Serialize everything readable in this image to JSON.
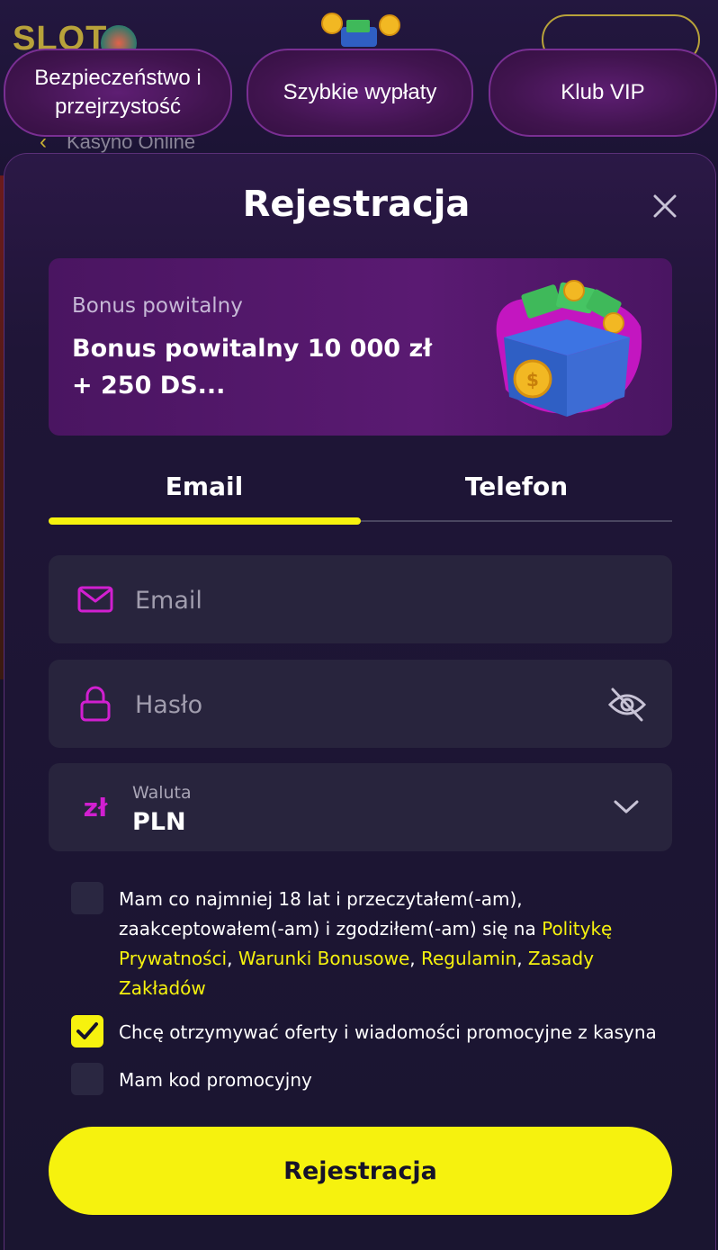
{
  "background": {
    "logo_text": "SLOTO",
    "back_link": "Kasyno Online"
  },
  "top_pills": [
    {
      "label": "Bezpieczeństwo i przejrzystość"
    },
    {
      "label": "Szybkie wypłaty"
    },
    {
      "label": "Klub VIP"
    }
  ],
  "modal": {
    "title": "Rejestracja",
    "close_icon": "close-icon"
  },
  "bonus": {
    "label": "Bonus powitalny",
    "value": "Bonus powitalny 10 000 zł + 250 DS..."
  },
  "tabs": [
    {
      "label": "Email",
      "active": true
    },
    {
      "label": "Telefon",
      "active": false
    }
  ],
  "fields": {
    "email": {
      "placeholder": "Email",
      "icon": "mail-icon"
    },
    "password": {
      "placeholder": "Hasło",
      "icon": "lock-icon",
      "toggle_icon": "eye-off-icon"
    },
    "currency": {
      "label": "Waluta",
      "value": "PLN",
      "glyph": "zł"
    }
  },
  "consents": {
    "age": {
      "checked": false,
      "text": "Mam co najmniej 18 lat i przeczytałem(-am), zaakceptowałem(-am) i zgodziłem(-am) się na",
      "links": [
        "Politykę Prywatności",
        "Warunki Bonusowe",
        "Regulamin",
        "Zasady Zakładów"
      ],
      "separator": ", "
    },
    "marketing": {
      "checked": true,
      "text": "Chcę otrzymywać oferty i wiadomości promocyjne z kasyna"
    },
    "promo": {
      "checked": false,
      "text": "Mam kod promocyjny"
    }
  },
  "submit_label": "Rejestracja",
  "colors": {
    "accent": "#f6f20e",
    "icon_magenta": "#d11fd0",
    "modal_bg": "#1a1530",
    "field_bg": "#28243d"
  }
}
